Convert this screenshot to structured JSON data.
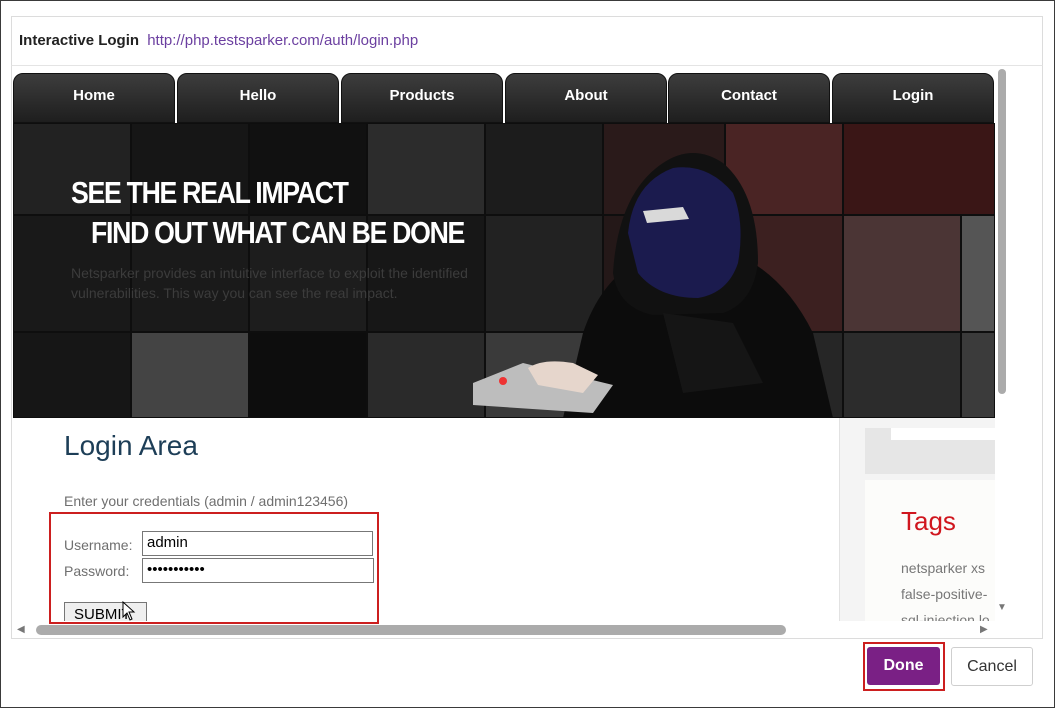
{
  "dialog": {
    "title": "Interactive Login",
    "url": "http://php.testsparker.com/auth/login.php"
  },
  "site": {
    "nav": [
      "Home",
      "Hello",
      "Products",
      "About",
      "Contact",
      "Login"
    ],
    "banner": {
      "heading1": "SEE THE REAL IMPACT",
      "heading2": "FIND OUT WHAT CAN BE DONE",
      "text": "Netsparker provides an intuitive interface to exploit the identified vulnerabilities. This way you can see the real impact."
    },
    "login": {
      "title": "Login Area",
      "instructions": "Enter your credentials (admin / admin123456)",
      "username_label": "Username:",
      "username_value": "admin",
      "password_label": "Password:",
      "password_value": "•••••••••••",
      "submit_label": "SUBMIT"
    },
    "sidebar": {
      "tags_title": "Tags",
      "tags": [
        "netsparker  xs",
        "false-positive-",
        "sql-injection  lo"
      ]
    }
  },
  "footer": {
    "done_label": "Done",
    "cancel_label": "Cancel"
  },
  "colors": {
    "accent": "#7a2085",
    "highlight": "#cc1f1f",
    "url": "#6b3fa0",
    "tags_title": "#d0161e"
  }
}
